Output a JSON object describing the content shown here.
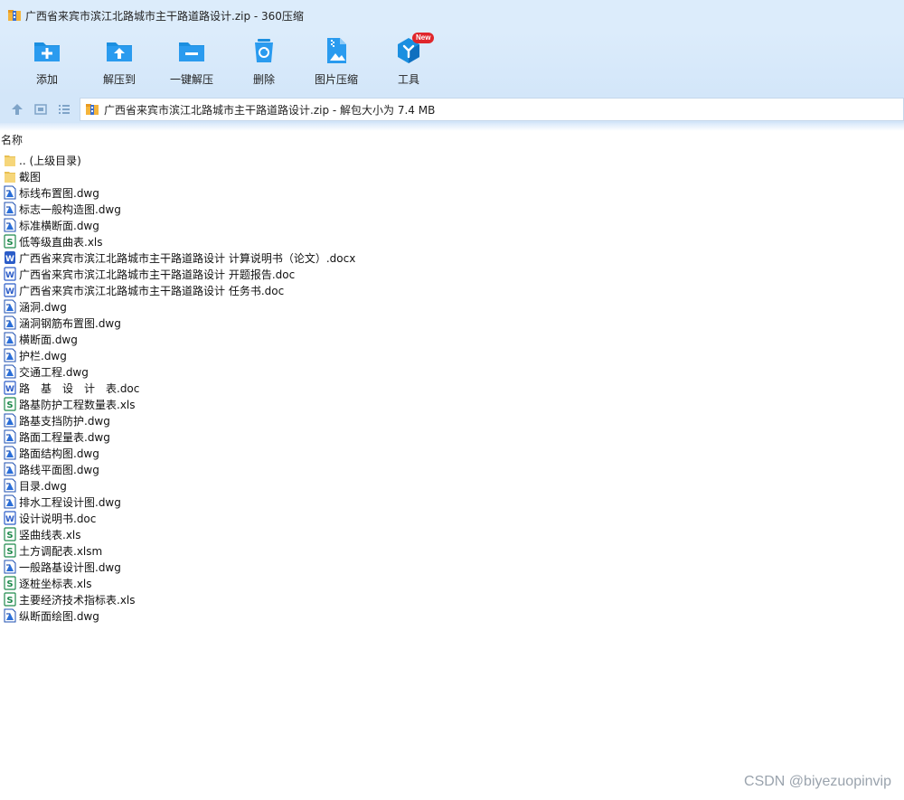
{
  "window": {
    "title": "广西省来宾市滨江北路城市主干路道路设计.zip - 360压缩"
  },
  "toolbar": {
    "add": "添加",
    "extract_to": "解压到",
    "one_click_extract": "一键解压",
    "delete": "删除",
    "image_compress": "图片压缩",
    "tools": "工具",
    "new_badge": "New"
  },
  "address": {
    "text": "广西省来宾市滨江北路城市主干路道路设计.zip - 解包大小为 7.4 MB"
  },
  "list": {
    "column_name": "名称",
    "items": [
      {
        "name": ".. (上级目录)",
        "type": "folder"
      },
      {
        "name": "截图",
        "type": "folder"
      },
      {
        "name": "标线布置图.dwg",
        "type": "dwg"
      },
      {
        "name": "标志一般构造图.dwg",
        "type": "dwg"
      },
      {
        "name": "标准横断面.dwg",
        "type": "dwg"
      },
      {
        "name": "低等级直曲表.xls",
        "type": "xls"
      },
      {
        "name": "广西省来宾市滨江北路城市主干路道路设计 计算说明书（论文）.docx",
        "type": "docx"
      },
      {
        "name": "广西省来宾市滨江北路城市主干路道路设计 开题报告.doc",
        "type": "doc"
      },
      {
        "name": "广西省来宾市滨江北路城市主干路道路设计 任务书.doc",
        "type": "doc"
      },
      {
        "name": "涵洞.dwg",
        "type": "dwg"
      },
      {
        "name": "涵洞钢筋布置图.dwg",
        "type": "dwg"
      },
      {
        "name": "横断面.dwg",
        "type": "dwg"
      },
      {
        "name": "护栏.dwg",
        "type": "dwg"
      },
      {
        "name": "交通工程.dwg",
        "type": "dwg"
      },
      {
        "name": "路　基　设　计　表.doc",
        "type": "doc"
      },
      {
        "name": "路基防护工程数量表.xls",
        "type": "xls"
      },
      {
        "name": "路基支挡防护.dwg",
        "type": "dwg"
      },
      {
        "name": "路面工程量表.dwg",
        "type": "dwg"
      },
      {
        "name": "路面结构图.dwg",
        "type": "dwg"
      },
      {
        "name": "路线平面图.dwg",
        "type": "dwg"
      },
      {
        "name": "目录.dwg",
        "type": "dwg"
      },
      {
        "name": "排水工程设计图.dwg",
        "type": "dwg"
      },
      {
        "name": "设计说明书.doc",
        "type": "doc"
      },
      {
        "name": "竖曲线表.xls",
        "type": "xls"
      },
      {
        "name": "土方调配表.xlsm",
        "type": "xls"
      },
      {
        "name": "一般路基设计图.dwg",
        "type": "dwg"
      },
      {
        "name": "逐桩坐标表.xls",
        "type": "xls"
      },
      {
        "name": "主要经济技术指标表.xls",
        "type": "xls"
      },
      {
        "name": "纵断面绘图.dwg",
        "type": "dwg"
      }
    ]
  },
  "watermark": "CSDN @biyezuopinvip",
  "colors": {
    "titlebar": "#dcecfb",
    "toolbar": "#d3e6f9",
    "icon_blue": "#1b8fe0",
    "badge_red": "#e0262b",
    "xls_green": "#1f8a4c",
    "doc_blue": "#2b5cc8",
    "folder_yellow": "#f6d67a"
  }
}
